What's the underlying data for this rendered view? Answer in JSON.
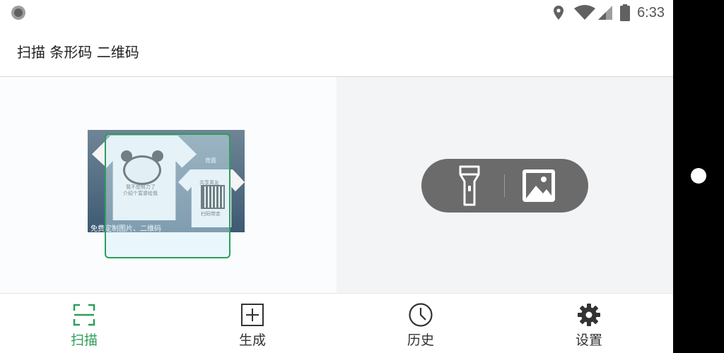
{
  "status_bar": {
    "time": "6:33",
    "icons": [
      "location-icon",
      "wifi-icon",
      "signal-icon",
      "battery-icon"
    ]
  },
  "app_bar": {
    "title": "扫描 条形码 二维码"
  },
  "camera": {
    "preview_caption": "免费定制图片、二维码",
    "shirt_front_text_1": "我不想努力了",
    "shirt_front_text_2": "介绍个富婆给我",
    "shirt_back_label": "背面",
    "shirt_back_text_1": "共享男友",
    "shirt_back_text_2": "扫码带走",
    "tools": {
      "flashlight_icon": "flashlight-icon",
      "gallery_icon": "image-icon"
    }
  },
  "bottom_nav": {
    "items": [
      {
        "label": "扫描",
        "icon": "scan-icon",
        "active": true
      },
      {
        "label": "生成",
        "icon": "add-box-icon",
        "active": false
      },
      {
        "label": "历史",
        "icon": "clock-icon",
        "active": false
      },
      {
        "label": "设置",
        "icon": "gear-icon",
        "active": false
      }
    ]
  },
  "colors": {
    "accent": "#2e9e5b",
    "tools_bg": "#6b6b6b"
  }
}
